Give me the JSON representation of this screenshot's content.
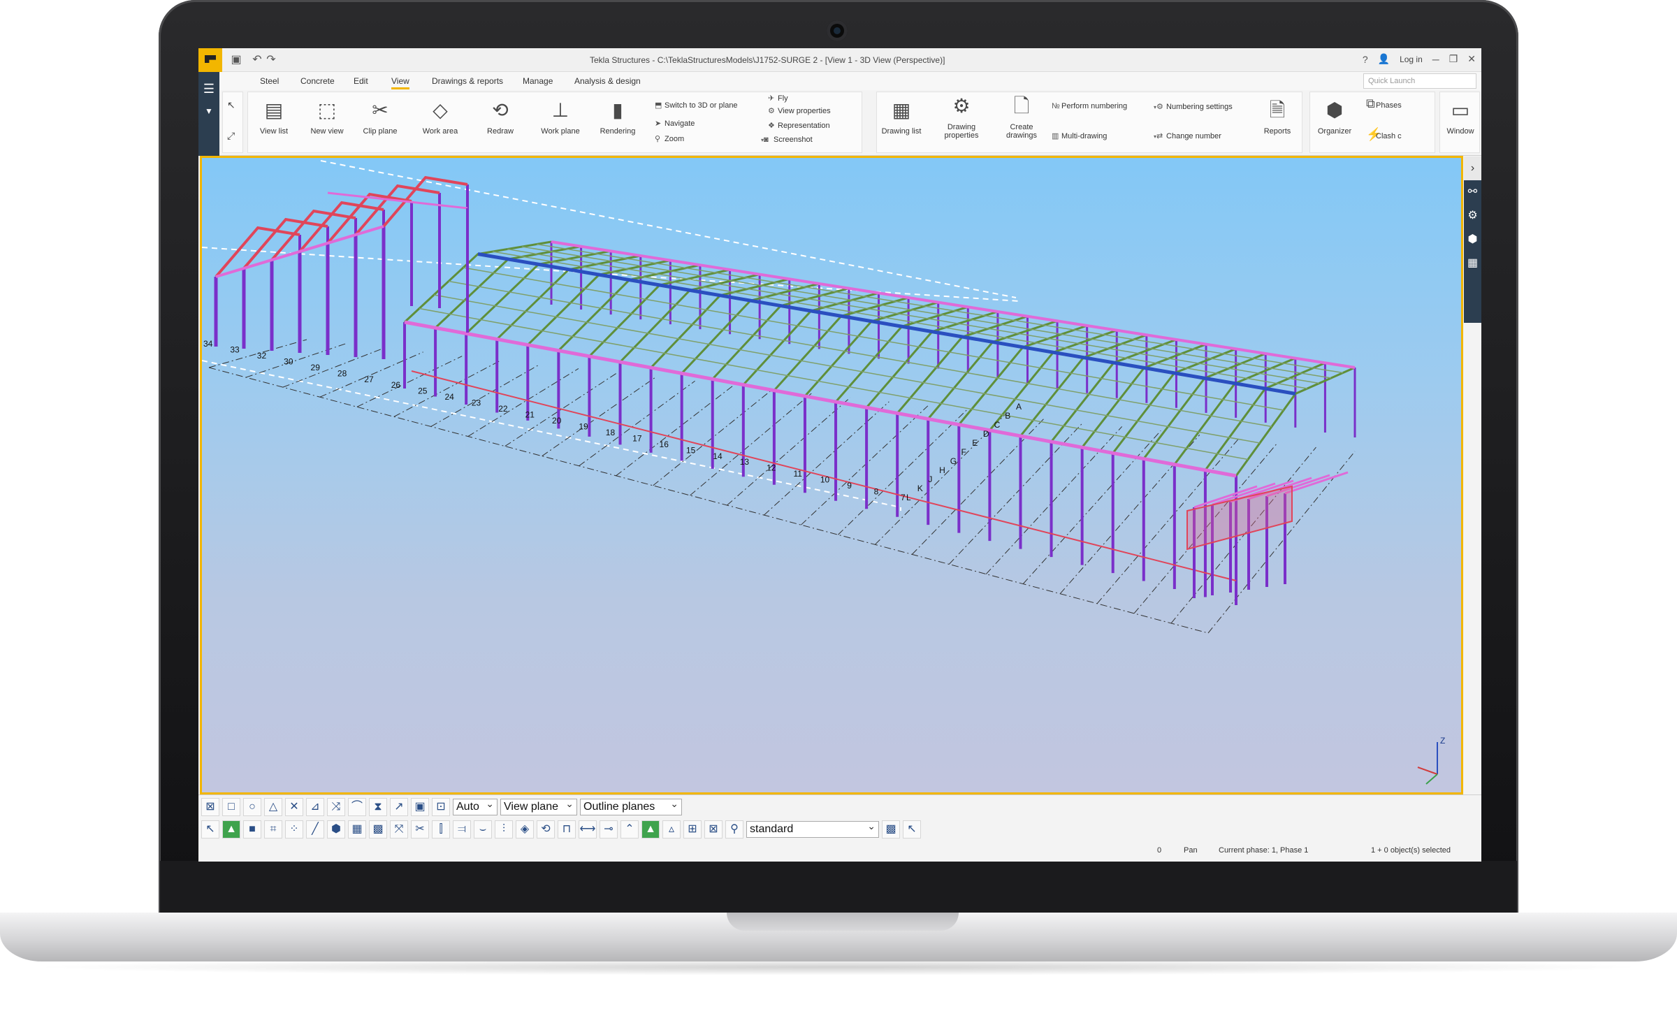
{
  "window": {
    "title": "Tekla Structures - C:\\TeklaStructuresModels\\J1752-SURGE 2 - [View 1 - 3D View (Perspective)]",
    "help": "?",
    "login": "Log in",
    "minimize": "─",
    "restore": "❐",
    "close": "✕"
  },
  "menu": {
    "tabs": [
      "Steel",
      "Concrete",
      "Edit",
      "View",
      "Drawings & reports",
      "Manage",
      "Analysis & design"
    ],
    "active": "View",
    "quick_launch_placeholder": "Quick Launch"
  },
  "ribbon": {
    "view": {
      "view_list": "View list",
      "new_view": "New view",
      "clip_plane": "Clip plane",
      "work_area": "Work area",
      "redraw": "Redraw",
      "work_plane": "Work plane",
      "rendering": "Rendering",
      "switch": "Switch to 3D or plane",
      "navigate": "Navigate",
      "zoom": "Zoom",
      "fly": "Fly",
      "view_properties": "View properties",
      "representation": "Representation",
      "screenshot": "Screenshot"
    },
    "drawings": {
      "drawing_list": "Drawing list",
      "drawing_properties_l1": "Drawing",
      "drawing_properties_l2": "properties",
      "create_drawings_l1": "Create",
      "create_drawings_l2": "drawings",
      "perform_numbering": "Perform numbering",
      "multi_drawing": "Multi-drawing",
      "numbering_settings": "Numbering settings",
      "change_number": "Change number",
      "reports": "Reports"
    },
    "manage": {
      "organizer": "Organizer",
      "phases": "Phases",
      "clash": "Clash c",
      "window": "Window"
    }
  },
  "viewport": {
    "grid_numbers": [
      "34",
      "33",
      "32",
      "30",
      "29",
      "28",
      "27",
      "26",
      "25",
      "24",
      "23",
      "22",
      "21",
      "20",
      "19",
      "18",
      "17",
      "16",
      "15",
      "14",
      "13",
      "12",
      "11",
      "10",
      "9",
      "8",
      "7"
    ],
    "grid_letters": [
      "A",
      "B",
      "C",
      "D",
      "E",
      "F",
      "G",
      "H",
      "J",
      "K",
      "L"
    ],
    "axis_z": "Z",
    "colors": {
      "column": "#7a2fc9",
      "rafter_pink": "#e06ad8",
      "beam_red": "#e0455a",
      "purlin_green": "#5f8f3a",
      "gridline": "#333333"
    }
  },
  "toolbars": {
    "snap_auto": "Auto",
    "view_plane": "View plane",
    "outline_planes": "Outline planes",
    "filter": "standard"
  },
  "status": {
    "count": "0",
    "mode": "Pan",
    "phase": "Current phase: 1, Phase 1",
    "selection": "1 + 0 object(s) selected"
  }
}
